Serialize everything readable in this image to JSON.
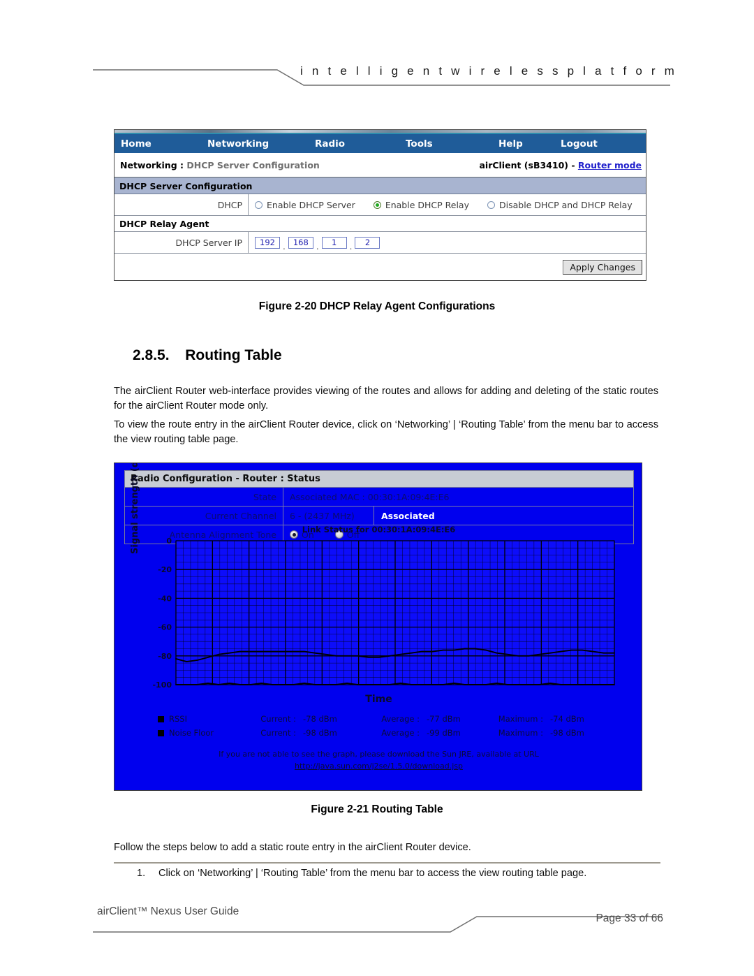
{
  "header": {
    "tagline": "i n t e l l i g e n t    w i r e l e s s    p l a t f o r m"
  },
  "dhcp_screenshot": {
    "nav": [
      {
        "label": "Home"
      },
      {
        "label": "Networking"
      },
      {
        "label": "Radio"
      },
      {
        "label": "Tools"
      },
      {
        "label": "Help"
      },
      {
        "label": "Logout"
      }
    ],
    "breadcrumb_prefix": "Networking : ",
    "breadcrumb_page": "DHCP Server Configuration",
    "device_label": "airClient (sB3410) - ",
    "device_mode_link": "Router mode",
    "section_title": "DHCP Server Configuration",
    "dhcp_row_label": "DHCP",
    "dhcp_options": [
      {
        "label": "Enable DHCP Server",
        "selected": false
      },
      {
        "label": "Enable DHCP Relay",
        "selected": true
      },
      {
        "label": "Disable DHCP and DHCP Relay",
        "selected": false
      }
    ],
    "relay_section_title": "DHCP Relay Agent",
    "server_ip_label": "DHCP Server IP",
    "server_ip_octets": [
      "192",
      "168",
      "1",
      "2"
    ],
    "apply_label": "Apply Changes"
  },
  "figure_20_caption": "Figure 2-20 DHCP Relay Agent Configurations",
  "section": {
    "number": "2.8.5.",
    "title": "Routing Table"
  },
  "paragraphs": {
    "p1": "The airClient Router web-interface provides viewing of the routes and allows for adding and deleting of the static routes for the airClient Router mode only.",
    "p2": "To view the route entry in the airClient Router device, click on ‘Networking’ | ‘Routing Table’ from the menu bar to access the view routing table page.",
    "p3": "Follow the steps below to add a static route entry in the airClient Router device."
  },
  "steps": [
    {
      "num": "1.",
      "text": "Click on ‘Networking’ | ‘Routing Table’ from the menu bar to access the view routing table page."
    }
  ],
  "radio_screenshot": {
    "panel_title": "Radio Configuration - Router : Status",
    "rows": [
      {
        "label": "State",
        "value": "Associated MAC : 00:30:1A:09:4E:E6"
      },
      {
        "label": "Current Channel",
        "value": "6 - (2437 MHz)",
        "value2": "Associated"
      },
      {
        "label": "Antenna Alignment Tone",
        "options": [
          {
            "label": "On",
            "selected": false
          },
          {
            "label": "Off",
            "selected": false
          }
        ]
      }
    ],
    "legend": [
      {
        "name": "RSSI",
        "current_label": "Current :",
        "current": "-78 dBm",
        "average_label": "Average :",
        "average": "-77 dBm",
        "maximum_label": "Maximum :",
        "maximum": "-74 dBm"
      },
      {
        "name": "Noise Floor",
        "current_label": "Current :",
        "current": "-98 dBm",
        "average_label": "Average :",
        "average": "-99 dBm",
        "maximum_label": "Maximum :",
        "maximum": "-98 dBm"
      }
    ],
    "note_line1": "If you are not able to see the graph, please download the Sun JRE, available at URL",
    "note_link": "http://java.sun.com/j2se/1.5.0/download.jsp"
  },
  "chart_data": {
    "type": "line",
    "title": "Link Status for 00:30:1A:09:4E:E6",
    "xlabel": "Time",
    "ylabel": "Signal strength (dBm)",
    "ylim": [
      -100,
      0
    ],
    "yticks": [
      0,
      -20,
      -40,
      -60,
      -80,
      -100
    ],
    "grid": true,
    "legend_position": "below",
    "series": [
      {
        "name": "RSSI",
        "color": "#000000",
        "values": [
          -82,
          -84,
          -83,
          -81,
          -79,
          -78,
          -77,
          -77,
          -77,
          -77,
          -77,
          -77,
          -77,
          -78,
          -79,
          -80,
          -80,
          -80,
          -81,
          -81,
          -80,
          -79,
          -78,
          -77,
          -77,
          -76,
          -76,
          -75,
          -75,
          -76,
          -78,
          -79,
          -80,
          -80,
          -79,
          -78,
          -77,
          -76,
          -76,
          -77,
          -78,
          -78
        ]
      },
      {
        "name": "Noise Floor",
        "color": "#000000",
        "values": [
          -100,
          -100,
          -100,
          -99,
          -100,
          -99,
          -100,
          -100,
          -99,
          -100,
          -100,
          -100,
          -99,
          -100,
          -100,
          -100,
          -99,
          -100,
          -100,
          -100,
          -100,
          -99,
          -100,
          -100,
          -100,
          -100,
          -99,
          -100,
          -100,
          -100,
          -99,
          -100,
          -100,
          -100,
          -100,
          -99,
          -100,
          -100,
          -100,
          -100,
          -100,
          -100
        ]
      }
    ]
  },
  "figure_21_caption": "Figure 2-21 Routing Table",
  "footer": {
    "left": "airClient™ Nexus User Guide",
    "right": "Page 33 of 66"
  }
}
